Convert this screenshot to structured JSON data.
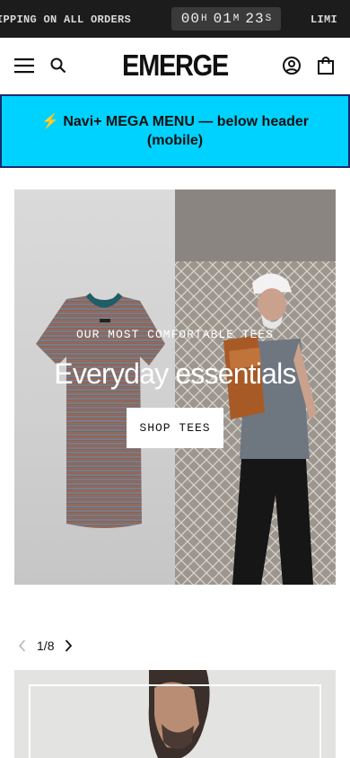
{
  "announcement": {
    "left_text": "IPPING ON ALL ORDERS",
    "right_text": "LIMI",
    "countdown": {
      "hours": "00",
      "hours_unit": "H",
      "minutes": "01",
      "minutes_unit": "M",
      "seconds": "23",
      "seconds_unit": "S"
    }
  },
  "header": {
    "logo": "EMERGE",
    "icons": {
      "menu": "hamburger-icon",
      "search": "search-icon",
      "account": "account-icon",
      "cart": "shopping-bag-icon"
    }
  },
  "mega_menu_banner": {
    "text": "⚡ Navi+ MEGA MENU — below header (mobile)",
    "background": "#00d2ff",
    "border": "#1a2a6c"
  },
  "hero": {
    "eyebrow": "OUR MOST COMFORTABLE TEES",
    "title": "Everyday essentials",
    "cta_label": "SHOP TEES"
  },
  "slider": {
    "current": "1",
    "separator": "/",
    "total": "8"
  },
  "colors": {
    "announcement_bg": "#1c1c1c",
    "text": "#111111"
  }
}
